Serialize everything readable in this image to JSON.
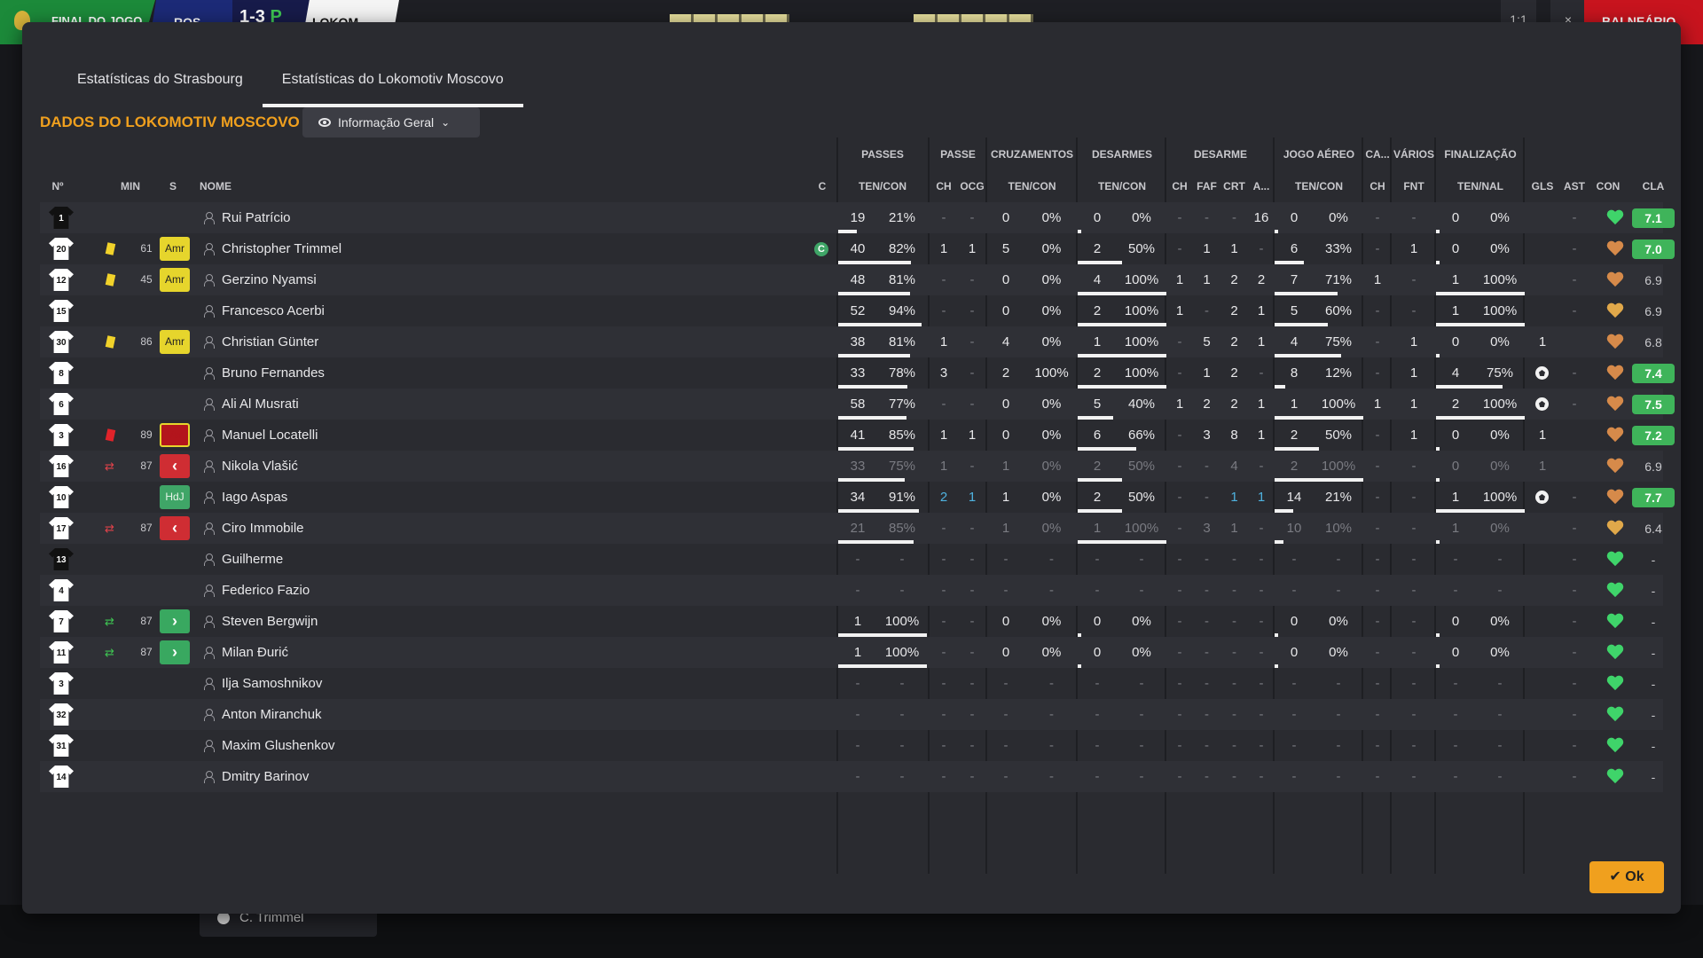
{
  "scoreboard": {
    "status": "FINAL DO JOGO",
    "team_a": "ROS",
    "score": "1-3",
    "score_p": "P",
    "team_b": "LOKOM",
    "right_label": "BALNEÁRIO",
    "btn_a": "1:1",
    "btn_b": "×"
  },
  "tabs": [
    "Estatísticas do Strasbourg",
    "Estatísticas do Lokomotiv Moscovo"
  ],
  "section_title": "DADOS DO LOKOMOTIV MOSCOVO",
  "view_dropdown": "Informação Geral",
  "groups": {
    "passes": "PASSES",
    "passe": "PASSE",
    "cruzamentos": "CRUZAMENTOS",
    "desarmes": "DESARMES",
    "desarme": "DESARME",
    "jogo_aereo": "JOGO AÉREO",
    "ca": "CA...",
    "varios": "VÁRIOS",
    "finalizacao": "FINALIZAÇÃO"
  },
  "headers": {
    "num": "Nº",
    "min": "MIN",
    "s": "S",
    "nome": "NOME",
    "c": "C",
    "pass_tc": "TEN/CON",
    "pass_ch": "CH",
    "pass_ocg": "OCG",
    "cruz_tc": "TEN/CON",
    "des_tc": "TEN/CON",
    "d_ch": "CH",
    "d_faf": "FAF",
    "d_crt": "CRT",
    "d_a": "A...",
    "aer_tc": "TEN/CON",
    "ca_ch": "CH",
    "fnt": "FNT",
    "fin_tn": "TEN/NAL",
    "gls": "GLS",
    "ast": "AST",
    "con": "CON",
    "cla": "CLA"
  },
  "players": [
    {
      "num": "1",
      "dark": true,
      "min": "",
      "card": "",
      "badge": "",
      "badge_type": "",
      "name": "Rui Patrício",
      "captain": "",
      "pt": "19",
      "pp": "21%",
      "pbar": 21,
      "pch": "-",
      "pocg": "-",
      "ct": "0",
      "cp": "0%",
      "dt": "0",
      "dp": "0%",
      "dbar": 0,
      "dch": "-",
      "dfaf": "-",
      "dcrt": "-",
      "da": "16",
      "at": "0",
      "ap": "0%",
      "abar": 0,
      "cach": "-",
      "fnt": "-",
      "ft": "0",
      "fp": "0%",
      "fbar": 0,
      "ball": false,
      "gls": "",
      "ast": "-",
      "con": "green",
      "cla": "7.1",
      "cla_green": true,
      "style": ""
    },
    {
      "num": "20",
      "dark": false,
      "min": "61",
      "card": "yellow",
      "badge": "Amr",
      "badge_type": "amr",
      "name": "Christopher Trimmel",
      "captain": "C",
      "pt": "40",
      "pp": "82%",
      "pbar": 82,
      "pch": "1",
      "pocg": "1",
      "ct": "5",
      "cp": "0%",
      "dt": "2",
      "dp": "50%",
      "dbar": 50,
      "dch": "-",
      "dfaf": "1",
      "dcrt": "1",
      "da": "-",
      "at": "6",
      "ap": "33%",
      "abar": 33,
      "cach": "-",
      "fnt": "1",
      "ft": "0",
      "fp": "0%",
      "fbar": 0,
      "ball": false,
      "gls": "",
      "ast": "-",
      "con": "orange",
      "cla": "7.0",
      "cla_green": true,
      "style": ""
    },
    {
      "num": "12",
      "dark": false,
      "min": "45",
      "card": "yellow",
      "badge": "Amr",
      "badge_type": "amr",
      "name": "Gerzino Nyamsi",
      "captain": "",
      "pt": "48",
      "pp": "81%",
      "pbar": 81,
      "pch": "-",
      "pocg": "-",
      "ct": "0",
      "cp": "0%",
      "dt": "4",
      "dp": "100%",
      "dbar": 100,
      "dch": "1",
      "dfaf": "1",
      "dcrt": "2",
      "da": "2",
      "at": "7",
      "ap": "71%",
      "abar": 71,
      "cach": "1",
      "fnt": "-",
      "ft": "1",
      "fp": "100%",
      "fbar": 100,
      "ball": false,
      "gls": "",
      "ast": "-",
      "con": "orange",
      "cla": "6.9",
      "cla_green": false,
      "style": ""
    },
    {
      "num": "15",
      "dark": false,
      "min": "",
      "card": "",
      "badge": "",
      "badge_type": "",
      "name": "Francesco Acerbi",
      "captain": "",
      "pt": "52",
      "pp": "94%",
      "pbar": 94,
      "pch": "-",
      "pocg": "-",
      "ct": "0",
      "cp": "0%",
      "dt": "2",
      "dp": "100%",
      "dbar": 100,
      "dch": "1",
      "dfaf": "-",
      "dcrt": "2",
      "da": "1",
      "at": "5",
      "ap": "60%",
      "abar": 60,
      "cach": "-",
      "fnt": "-",
      "ft": "1",
      "fp": "100%",
      "fbar": 100,
      "ball": false,
      "gls": "",
      "ast": "-",
      "con": "gold",
      "cla": "6.9",
      "cla_green": false,
      "style": ""
    },
    {
      "num": "30",
      "dark": false,
      "min": "86",
      "card": "yellow",
      "badge": "Amr",
      "badge_type": "amr",
      "name": "Christian Günter",
      "captain": "",
      "pt": "38",
      "pp": "81%",
      "pbar": 81,
      "pch": "1",
      "pocg": "-",
      "ct": "4",
      "cp": "0%",
      "dt": "1",
      "dp": "100%",
      "dbar": 100,
      "dch": "-",
      "dfaf": "5",
      "dcrt": "2",
      "da": "1",
      "at": "4",
      "ap": "75%",
      "abar": 75,
      "cach": "-",
      "fnt": "1",
      "ft": "0",
      "fp": "0%",
      "fbar": 0,
      "ball": false,
      "gls": "1",
      "ast": "",
      "con": "orange",
      "cla": "6.8",
      "cla_green": false,
      "style": ""
    },
    {
      "num": "8",
      "dark": false,
      "min": "",
      "card": "",
      "badge": "",
      "badge_type": "",
      "name": "Bruno Fernandes",
      "captain": "",
      "pt": "33",
      "pp": "78%",
      "pbar": 78,
      "pch": "3",
      "pocg": "-",
      "ct": "2",
      "cp": "100%",
      "dt": "2",
      "dp": "100%",
      "dbar": 100,
      "dch": "-",
      "dfaf": "1",
      "dcrt": "2",
      "da": "-",
      "at": "8",
      "ap": "12%",
      "abar": 12,
      "cach": "-",
      "fnt": "1",
      "ft": "4",
      "fp": "75%",
      "fbar": 75,
      "ball": true,
      "gls": "",
      "ast": "-",
      "con": "orange",
      "cla": "7.4",
      "cla_green": true,
      "style": ""
    },
    {
      "num": "6",
      "dark": false,
      "min": "",
      "card": "",
      "badge": "",
      "badge_type": "",
      "name": "Ali Al Musrati",
      "captain": "",
      "pt": "58",
      "pp": "77%",
      "pbar": 77,
      "pch": "-",
      "pocg": "-",
      "ct": "0",
      "cp": "0%",
      "dt": "5",
      "dp": "40%",
      "dbar": 40,
      "dch": "1",
      "dfaf": "2",
      "dcrt": "2",
      "da": "1",
      "at": "1",
      "ap": "100%",
      "abar": 100,
      "cach": "1",
      "fnt": "1",
      "ft": "2",
      "fp": "100%",
      "fbar": 100,
      "ball": true,
      "gls": "",
      "ast": "-",
      "con": "orange",
      "cla": "7.5",
      "cla_green": true,
      "style": ""
    },
    {
      "num": "3",
      "dark": false,
      "min": "89",
      "card": "red",
      "badge": "Ver",
      "badge_type": "ver",
      "name": "Manuel Locatelli",
      "captain": "",
      "pt": "41",
      "pp": "85%",
      "pbar": 85,
      "pch": "1",
      "pocg": "1",
      "ct": "0",
      "cp": "0%",
      "dt": "6",
      "dp": "66%",
      "dbar": 66,
      "dch": "-",
      "dfaf": "3",
      "dcrt": "8",
      "da": "1",
      "at": "2",
      "ap": "50%",
      "abar": 50,
      "cach": "-",
      "fnt": "1",
      "ft": "0",
      "fp": "0%",
      "fbar": 0,
      "ball": false,
      "gls": "1",
      "ast": "",
      "con": "orange",
      "cla": "7.2",
      "cla_green": true,
      "style": ""
    },
    {
      "num": "16",
      "dark": false,
      "min": "87",
      "card": "subout",
      "badge": "‹",
      "badge_type": "out",
      "name": "Nikola Vlašić",
      "captain": "",
      "pt": "33",
      "pp": "75%",
      "pbar": 75,
      "pch": "1",
      "pocg": "-",
      "ct": "1",
      "cp": "0%",
      "dt": "2",
      "dp": "50%",
      "dbar": 50,
      "dch": "-",
      "dfaf": "-",
      "dcrt": "4",
      "da": "-",
      "at": "2",
      "ap": "100%",
      "abar": 100,
      "cach": "-",
      "fnt": "-",
      "ft": "0",
      "fp": "0%",
      "fbar": 0,
      "ball": false,
      "gls": "1",
      "ast": "",
      "con": "orange",
      "cla": "6.9",
      "cla_green": false,
      "style": "dimmed"
    },
    {
      "num": "10",
      "dark": false,
      "min": "",
      "card": "",
      "badge": "HdJ",
      "badge_type": "hdj",
      "name": "Iago Aspas",
      "captain": "",
      "pt": "34",
      "pp": "91%",
      "pbar": 91,
      "pch": "2",
      "pocg": "1",
      "ct": "1",
      "cp": "0%",
      "dt": "2",
      "dp": "50%",
      "dbar": 50,
      "dch": "-",
      "dfaf": "-",
      "dcrt": "1",
      "da": "1",
      "at": "14",
      "ap": "21%",
      "abar": 21,
      "cach": "-",
      "fnt": "-",
      "ft": "1",
      "fp": "100%",
      "fbar": 100,
      "ball": true,
      "gls": "",
      "ast": "-",
      "con": "orange",
      "cla": "7.7",
      "cla_green": true,
      "style": "link"
    },
    {
      "num": "17",
      "dark": false,
      "min": "87",
      "card": "subout",
      "badge": "‹",
      "badge_type": "out",
      "name": "Ciro Immobile",
      "captain": "",
      "pt": "21",
      "pp": "85%",
      "pbar": 85,
      "pch": "-",
      "pocg": "-",
      "ct": "1",
      "cp": "0%",
      "dt": "1",
      "dp": "100%",
      "dbar": 100,
      "dch": "-",
      "dfaf": "3",
      "dcrt": "1",
      "da": "-",
      "at": "10",
      "ap": "10%",
      "abar": 10,
      "cach": "-",
      "fnt": "-",
      "ft": "1",
      "fp": "0%",
      "fbar": 0,
      "ball": false,
      "gls": "",
      "ast": "-",
      "con": "gold",
      "cla": "6.4",
      "cla_green": false,
      "style": "dimmed"
    },
    {
      "num": "13",
      "dark": true,
      "min": "",
      "card": "",
      "badge": "",
      "badge_type": "",
      "name": "Guilherme",
      "captain": "",
      "pt": "-",
      "pp": "-",
      "pbar": 0,
      "pch": "-",
      "pocg": "-",
      "ct": "-",
      "cp": "-",
      "dt": "-",
      "dp": "-",
      "dbar": 0,
      "dch": "-",
      "dfaf": "-",
      "dcrt": "-",
      "da": "-",
      "at": "-",
      "ap": "-",
      "abar": 0,
      "cach": "-",
      "fnt": "-",
      "ft": "-",
      "fp": "-",
      "fbar": 0,
      "ball": false,
      "gls": "",
      "ast": "-",
      "con": "green",
      "cla": "-",
      "cla_green": false,
      "style": "dimmed"
    },
    {
      "num": "4",
      "dark": false,
      "min": "",
      "card": "",
      "badge": "",
      "badge_type": "",
      "name": "Federico Fazio",
      "captain": "",
      "pt": "-",
      "pp": "-",
      "pbar": 0,
      "pch": "-",
      "pocg": "-",
      "ct": "-",
      "cp": "-",
      "dt": "-",
      "dp": "-",
      "dbar": 0,
      "dch": "-",
      "dfaf": "-",
      "dcrt": "-",
      "da": "-",
      "at": "-",
      "ap": "-",
      "abar": 0,
      "cach": "-",
      "fnt": "-",
      "ft": "-",
      "fp": "-",
      "fbar": 0,
      "ball": false,
      "gls": "",
      "ast": "-",
      "con": "green",
      "cla": "-",
      "cla_green": false,
      "style": "dimmed"
    },
    {
      "num": "7",
      "dark": false,
      "min": "87",
      "card": "subin",
      "badge": "›",
      "badge_type": "in",
      "name": "Steven Bergwijn",
      "captain": "",
      "pt": "1",
      "pp": "100%",
      "pbar": 100,
      "pch": "-",
      "pocg": "-",
      "ct": "0",
      "cp": "0%",
      "dt": "0",
      "dp": "0%",
      "dbar": 0,
      "dch": "-",
      "dfaf": "-",
      "dcrt": "-",
      "da": "-",
      "at": "0",
      "ap": "0%",
      "abar": 0,
      "cach": "-",
      "fnt": "-",
      "ft": "0",
      "fp": "0%",
      "fbar": 0,
      "ball": false,
      "gls": "",
      "ast": "-",
      "con": "green",
      "cla": "-",
      "cla_green": false,
      "style": ""
    },
    {
      "num": "11",
      "dark": false,
      "min": "87",
      "card": "subin",
      "badge": "›",
      "badge_type": "in",
      "name": "Milan Đurić",
      "captain": "",
      "pt": "1",
      "pp": "100%",
      "pbar": 100,
      "pch": "-",
      "pocg": "-",
      "ct": "0",
      "cp": "0%",
      "dt": "0",
      "dp": "0%",
      "dbar": 0,
      "dch": "-",
      "dfaf": "-",
      "dcrt": "-",
      "da": "-",
      "at": "0",
      "ap": "0%",
      "abar": 0,
      "cach": "-",
      "fnt": "-",
      "ft": "0",
      "fp": "0%",
      "fbar": 0,
      "ball": false,
      "gls": "",
      "ast": "-",
      "con": "green",
      "cla": "-",
      "cla_green": false,
      "style": ""
    },
    {
      "num": "3",
      "dark": false,
      "min": "",
      "card": "",
      "badge": "",
      "badge_type": "",
      "name": "Ilja Samoshnikov",
      "captain": "",
      "pt": "-",
      "pp": "-",
      "pbar": 0,
      "pch": "-",
      "pocg": "-",
      "ct": "-",
      "cp": "-",
      "dt": "-",
      "dp": "-",
      "dbar": 0,
      "dch": "-",
      "dfaf": "-",
      "dcrt": "-",
      "da": "-",
      "at": "-",
      "ap": "-",
      "abar": 0,
      "cach": "-",
      "fnt": "-",
      "ft": "-",
      "fp": "-",
      "fbar": 0,
      "ball": false,
      "gls": "",
      "ast": "-",
      "con": "green",
      "cla": "-",
      "cla_green": false,
      "style": "dimmed"
    },
    {
      "num": "32",
      "dark": false,
      "min": "",
      "card": "",
      "badge": "",
      "badge_type": "",
      "name": "Anton Miranchuk",
      "captain": "",
      "pt": "-",
      "pp": "-",
      "pbar": 0,
      "pch": "-",
      "pocg": "-",
      "ct": "-",
      "cp": "-",
      "dt": "-",
      "dp": "-",
      "dbar": 0,
      "dch": "-",
      "dfaf": "-",
      "dcrt": "-",
      "da": "-",
      "at": "-",
      "ap": "-",
      "abar": 0,
      "cach": "-",
      "fnt": "-",
      "ft": "-",
      "fp": "-",
      "fbar": 0,
      "ball": false,
      "gls": "",
      "ast": "-",
      "con": "green",
      "cla": "-",
      "cla_green": false,
      "style": "dimmed"
    },
    {
      "num": "31",
      "dark": false,
      "min": "",
      "card": "",
      "badge": "",
      "badge_type": "",
      "name": "Maxim Glushenkov",
      "captain": "",
      "pt": "-",
      "pp": "-",
      "pbar": 0,
      "pch": "-",
      "pocg": "-",
      "ct": "-",
      "cp": "-",
      "dt": "-",
      "dp": "-",
      "dbar": 0,
      "dch": "-",
      "dfaf": "-",
      "dcrt": "-",
      "da": "-",
      "at": "-",
      "ap": "-",
      "abar": 0,
      "cach": "-",
      "fnt": "-",
      "ft": "-",
      "fp": "-",
      "fbar": 0,
      "ball": false,
      "gls": "",
      "ast": "-",
      "con": "green",
      "cla": "-",
      "cla_green": false,
      "style": "dimmed"
    },
    {
      "num": "14",
      "dark": false,
      "min": "",
      "card": "",
      "badge": "",
      "badge_type": "",
      "name": "Dmitry Barinov",
      "captain": "",
      "pt": "-",
      "pp": "-",
      "pbar": 0,
      "pch": "-",
      "pocg": "-",
      "ct": "-",
      "cp": "-",
      "dt": "-",
      "dp": "-",
      "dbar": 0,
      "dch": "-",
      "dfaf": "-",
      "dcrt": "-",
      "da": "-",
      "at": "-",
      "ap": "-",
      "abar": 0,
      "cach": "-",
      "fnt": "-",
      "ft": "-",
      "fp": "-",
      "fbar": 0,
      "ball": false,
      "gls": "",
      "ast": "-",
      "con": "green",
      "cla": "-",
      "cla_green": false,
      "style": "dimmed"
    }
  ],
  "heart_colors": {
    "green": "#3fd46a",
    "orange": "#d68a4a",
    "gold": "#e0a84a"
  },
  "bottom_chip": "C. Trimmel",
  "ok_label": "Ok"
}
